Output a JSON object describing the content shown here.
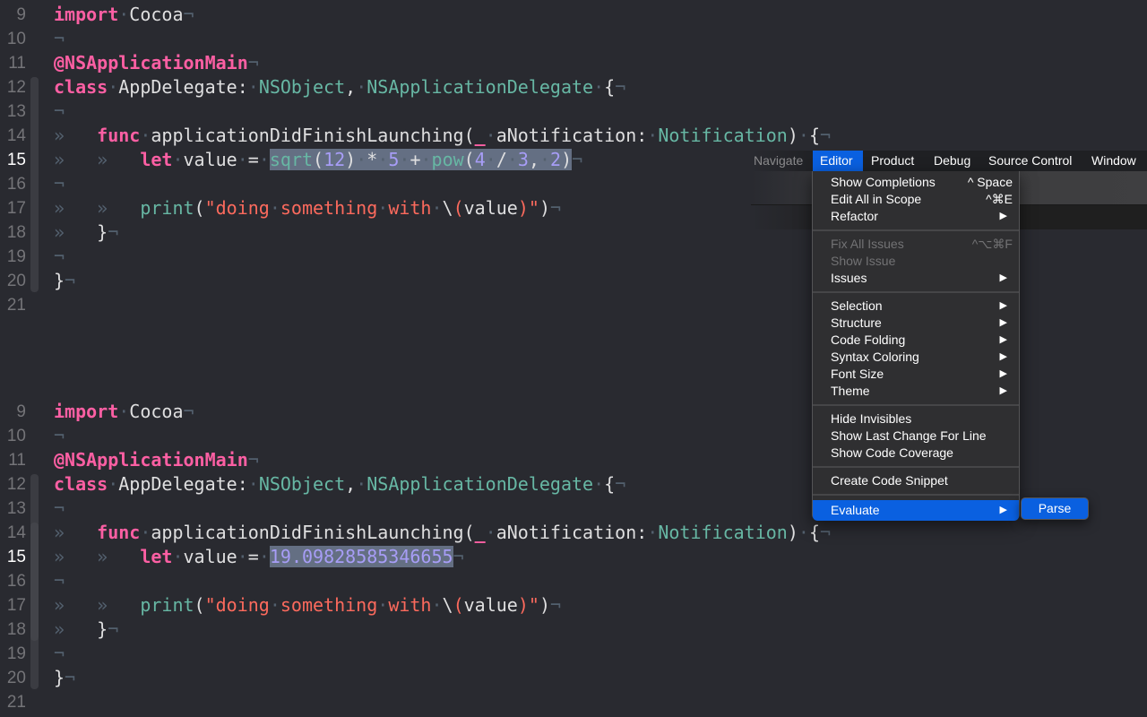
{
  "colors": {
    "background": "#292a30",
    "keyword": "#fc5fa3",
    "type": "#67b7a4",
    "number": "#a79df6",
    "string": "#fc6a5d",
    "plain": "#dfdfe0",
    "selection": "#646f83",
    "menu_highlight": "#0a60e0"
  },
  "editors": [
    {
      "name": "before",
      "lines": [
        {
          "n": "9",
          "tokens": [
            [
              "kw",
              "import"
            ],
            [
              "inv",
              "·"
            ],
            [
              "plain",
              "Cocoa"
            ],
            [
              "inv",
              "¬"
            ]
          ]
        },
        {
          "n": "10",
          "tokens": [
            [
              "inv",
              "¬"
            ]
          ]
        },
        {
          "n": "11",
          "tokens": [
            [
              "attr",
              "@NSApplicationMain"
            ],
            [
              "inv",
              "¬"
            ]
          ]
        },
        {
          "n": "12",
          "tokens": [
            [
              "kw",
              "class"
            ],
            [
              "inv",
              "·"
            ],
            [
              "plain",
              "AppDelegate:"
            ],
            [
              "inv",
              "·"
            ],
            [
              "type",
              "NSObject"
            ],
            [
              "plain",
              ","
            ],
            [
              "inv",
              "·"
            ],
            [
              "type",
              "NSApplicationDelegate"
            ],
            [
              "inv",
              "·"
            ],
            [
              "plain",
              "{"
            ],
            [
              "inv",
              "¬"
            ]
          ]
        },
        {
          "n": "13",
          "tokens": [
            [
              "inv",
              "¬"
            ]
          ]
        },
        {
          "n": "14",
          "tokens": [
            [
              "inv",
              "»   "
            ],
            [
              "kw",
              "func"
            ],
            [
              "inv",
              "·"
            ],
            [
              "plain",
              "applicationDidFinishLaunching("
            ],
            [
              "kw",
              "_"
            ],
            [
              "inv",
              "·"
            ],
            [
              "plain",
              "aNotification:"
            ],
            [
              "inv",
              "·"
            ],
            [
              "type",
              "Notification"
            ],
            [
              "plain",
              ")"
            ],
            [
              "inv",
              "·"
            ],
            [
              "plain",
              "{"
            ],
            [
              "inv",
              "¬"
            ]
          ]
        },
        {
          "n": "15",
          "current": true,
          "tokens": [
            [
              "inv",
              "»   »   "
            ],
            [
              "kw",
              "let"
            ],
            [
              "inv",
              "·"
            ],
            [
              "plain",
              "value"
            ],
            [
              "inv",
              "·"
            ],
            [
              "plain",
              "="
            ],
            [
              "inv",
              "·"
            ],
            [
              "fn sel",
              "sqrt"
            ],
            [
              "plain sel",
              "("
            ],
            [
              "num sel",
              "12"
            ],
            [
              "plain sel",
              ")"
            ],
            [
              "inv sel",
              "·"
            ],
            [
              "plain sel",
              "*"
            ],
            [
              "inv sel",
              "·"
            ],
            [
              "num sel",
              "5"
            ],
            [
              "inv sel",
              "·"
            ],
            [
              "plain sel",
              "+"
            ],
            [
              "inv sel",
              "·"
            ],
            [
              "fn sel",
              "pow"
            ],
            [
              "plain sel",
              "("
            ],
            [
              "num sel",
              "4"
            ],
            [
              "inv sel",
              "·"
            ],
            [
              "plain sel",
              "/"
            ],
            [
              "inv sel",
              "·"
            ],
            [
              "num sel",
              "3"
            ],
            [
              "plain sel",
              ","
            ],
            [
              "inv sel",
              "·"
            ],
            [
              "num sel",
              "2"
            ],
            [
              "plain sel",
              ")"
            ],
            [
              "inv",
              "¬"
            ]
          ]
        },
        {
          "n": "16",
          "tokens": [
            [
              "inv",
              "¬"
            ]
          ]
        },
        {
          "n": "17",
          "tokens": [
            [
              "inv",
              "»   »   "
            ],
            [
              "fn",
              "print"
            ],
            [
              "plain",
              "("
            ],
            [
              "str",
              "\"doing"
            ],
            [
              "inv",
              "·"
            ],
            [
              "str",
              "something"
            ],
            [
              "inv",
              "·"
            ],
            [
              "str",
              "with"
            ],
            [
              "inv",
              "·"
            ],
            [
              "plain",
              "\\"
            ],
            [
              "str",
              "("
            ],
            [
              "plain",
              "value"
            ],
            [
              "str",
              ")"
            ],
            [
              "str",
              "\""
            ],
            [
              "plain",
              ")"
            ],
            [
              "inv",
              "¬"
            ]
          ]
        },
        {
          "n": "18",
          "tokens": [
            [
              "inv",
              "»   "
            ],
            [
              "plain",
              "}"
            ],
            [
              "inv",
              "¬"
            ]
          ]
        },
        {
          "n": "19",
          "tokens": [
            [
              "inv",
              "¬"
            ]
          ]
        },
        {
          "n": "20",
          "tokens": [
            [
              "plain",
              "}"
            ],
            [
              "inv",
              "¬"
            ]
          ]
        },
        {
          "n": "21",
          "tokens": []
        }
      ]
    },
    {
      "name": "after",
      "lines": [
        {
          "n": "9",
          "tokens": [
            [
              "kw",
              "import"
            ],
            [
              "inv",
              "·"
            ],
            [
              "plain",
              "Cocoa"
            ],
            [
              "inv",
              "¬"
            ]
          ]
        },
        {
          "n": "10",
          "tokens": [
            [
              "inv",
              "¬"
            ]
          ]
        },
        {
          "n": "11",
          "tokens": [
            [
              "attr",
              "@NSApplicationMain"
            ],
            [
              "inv",
              "¬"
            ]
          ]
        },
        {
          "n": "12",
          "tokens": [
            [
              "kw",
              "class"
            ],
            [
              "inv",
              "·"
            ],
            [
              "plain",
              "AppDelegate:"
            ],
            [
              "inv",
              "·"
            ],
            [
              "type",
              "NSObject"
            ],
            [
              "plain",
              ","
            ],
            [
              "inv",
              "·"
            ],
            [
              "type",
              "NSApplicationDelegate"
            ],
            [
              "inv",
              "·"
            ],
            [
              "plain",
              "{"
            ],
            [
              "inv",
              "¬"
            ]
          ]
        },
        {
          "n": "13",
          "tokens": [
            [
              "inv",
              "¬"
            ]
          ]
        },
        {
          "n": "14",
          "tokens": [
            [
              "inv",
              "»   "
            ],
            [
              "kw",
              "func"
            ],
            [
              "inv",
              "·"
            ],
            [
              "plain",
              "applicationDidFinishLaunching("
            ],
            [
              "kw",
              "_"
            ],
            [
              "inv",
              "·"
            ],
            [
              "plain",
              "aNotification:"
            ],
            [
              "inv",
              "·"
            ],
            [
              "type",
              "Notification"
            ],
            [
              "plain",
              ")"
            ],
            [
              "inv",
              "·"
            ],
            [
              "plain",
              "{"
            ],
            [
              "inv",
              "¬"
            ]
          ]
        },
        {
          "n": "15",
          "current": true,
          "tokens": [
            [
              "inv",
              "»   »   "
            ],
            [
              "kw",
              "let"
            ],
            [
              "inv",
              "·"
            ],
            [
              "plain",
              "value"
            ],
            [
              "inv",
              "·"
            ],
            [
              "plain",
              "="
            ],
            [
              "inv",
              "·"
            ],
            [
              "num sel",
              "19.09828585346655"
            ],
            [
              "inv",
              "¬"
            ]
          ]
        },
        {
          "n": "16",
          "tokens": [
            [
              "inv",
              "¬"
            ]
          ]
        },
        {
          "n": "17",
          "tokens": [
            [
              "inv",
              "»   »   "
            ],
            [
              "fn",
              "print"
            ],
            [
              "plain",
              "("
            ],
            [
              "str",
              "\"doing"
            ],
            [
              "inv",
              "·"
            ],
            [
              "str",
              "something"
            ],
            [
              "inv",
              "·"
            ],
            [
              "str",
              "with"
            ],
            [
              "inv",
              "·"
            ],
            [
              "plain",
              "\\"
            ],
            [
              "str",
              "("
            ],
            [
              "plain",
              "value"
            ],
            [
              "str",
              ")"
            ],
            [
              "str",
              "\""
            ],
            [
              "plain",
              ")"
            ],
            [
              "inv",
              "¬"
            ]
          ]
        },
        {
          "n": "18",
          "tokens": [
            [
              "inv",
              "»   "
            ],
            [
              "plain",
              "}"
            ],
            [
              "inv",
              "¬"
            ]
          ]
        },
        {
          "n": "19",
          "tokens": [
            [
              "inv",
              "¬"
            ]
          ]
        },
        {
          "n": "20",
          "tokens": [
            [
              "plain",
              "}"
            ],
            [
              "inv",
              "¬"
            ]
          ]
        },
        {
          "n": "21",
          "tokens": []
        }
      ]
    }
  ],
  "menubar": {
    "items": [
      "Navigate",
      "Editor",
      "Product",
      "Debug",
      "Source Control",
      "Window"
    ],
    "active": "Editor"
  },
  "editor_menu": {
    "items": [
      {
        "label": "Show Completions",
        "shortcut": "^ Space"
      },
      {
        "label": "Edit All in Scope",
        "shortcut": "^⌘E"
      },
      {
        "label": "Refactor",
        "submenu": true
      },
      {
        "separator": true
      },
      {
        "label": "Fix All Issues",
        "shortcut": "^⌥⌘F",
        "disabled": true
      },
      {
        "label": "Show Issue",
        "disabled": true
      },
      {
        "label": "Issues",
        "submenu": true
      },
      {
        "separator": true
      },
      {
        "label": "Selection",
        "submenu": true
      },
      {
        "label": "Structure",
        "submenu": true
      },
      {
        "label": "Code Folding",
        "submenu": true
      },
      {
        "label": "Syntax Coloring",
        "submenu": true
      },
      {
        "label": "Font Size",
        "submenu": true
      },
      {
        "label": "Theme",
        "submenu": true
      },
      {
        "separator": true
      },
      {
        "label": "Hide Invisibles"
      },
      {
        "label": "Show Last Change For Line"
      },
      {
        "label": "Show Code Coverage"
      },
      {
        "separator": true
      },
      {
        "label": "Create Code Snippet"
      },
      {
        "separator": true
      },
      {
        "label": "Evaluate",
        "submenu": true,
        "highlighted": true
      }
    ],
    "submenu_arrow": "▶"
  },
  "evaluate_submenu": {
    "items": [
      {
        "label": "Parse",
        "highlighted": true
      }
    ]
  }
}
